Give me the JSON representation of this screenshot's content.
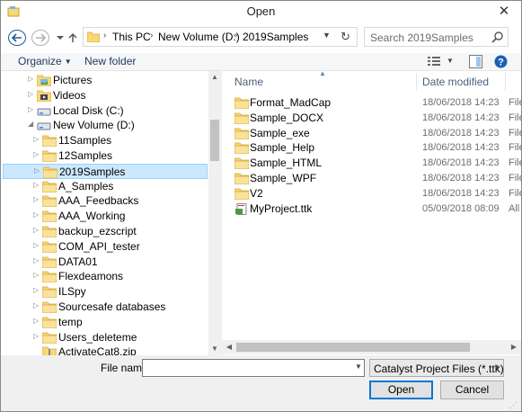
{
  "window": {
    "title": "Open",
    "close_glyph": "✕"
  },
  "nav": {
    "back_icon": "back-arrow-icon",
    "forward_icon": "forward-arrow-icon",
    "recent_icon": "chevron-down-icon",
    "up_icon": "up-arrow-icon",
    "breadcrumb": [
      "This PC",
      "New Volume (D:)",
      "2019Samples"
    ],
    "refresh_glyph": "↻"
  },
  "search": {
    "placeholder": "Search 2019Samples"
  },
  "toolbar": {
    "organize": "Organize",
    "new_folder": "New folder"
  },
  "tree": [
    {
      "label": "Pictures",
      "icon": "pictures-icon",
      "indent": 1,
      "selected": false
    },
    {
      "label": "Videos",
      "icon": "videos-icon",
      "indent": 1,
      "selected": false
    },
    {
      "label": "Local Disk (C:)",
      "icon": "drive-icon",
      "indent": 1,
      "selected": false
    },
    {
      "label": "New Volume (D:)",
      "icon": "drive-icon",
      "indent": 1,
      "expanded": true,
      "selected": false
    },
    {
      "label": "11Samples",
      "icon": "folder-icon",
      "indent": 2,
      "selected": false
    },
    {
      "label": "12Samples",
      "icon": "folder-icon",
      "indent": 2,
      "selected": false
    },
    {
      "label": "2019Samples",
      "icon": "folder-icon",
      "indent": 2,
      "selected": true
    },
    {
      "label": "A_Samples",
      "icon": "folder-icon",
      "indent": 2,
      "selected": false
    },
    {
      "label": "AAA_Feedbacks",
      "icon": "folder-icon",
      "indent": 2,
      "selected": false
    },
    {
      "label": "AAA_Working",
      "icon": "folder-icon",
      "indent": 2,
      "selected": false
    },
    {
      "label": "backup_ezscript",
      "icon": "folder-icon",
      "indent": 2,
      "selected": false
    },
    {
      "label": "COM_API_tester",
      "icon": "folder-icon",
      "indent": 2,
      "selected": false
    },
    {
      "label": "DATA01",
      "icon": "folder-icon",
      "indent": 2,
      "selected": false
    },
    {
      "label": "Flexdeamons",
      "icon": "folder-icon",
      "indent": 2,
      "selected": false
    },
    {
      "label": "ILSpy",
      "icon": "folder-icon",
      "indent": 2,
      "selected": false
    },
    {
      "label": "Sourcesafe databases",
      "icon": "folder-icon",
      "indent": 2,
      "selected": false
    },
    {
      "label": "temp",
      "icon": "folder-icon",
      "indent": 2,
      "selected": false
    },
    {
      "label": "Users_deleteme",
      "icon": "folder-icon",
      "indent": 2,
      "selected": false
    },
    {
      "label": "ActivateCat8.zip",
      "icon": "zip-icon",
      "indent": 2,
      "file": true,
      "selected": false
    }
  ],
  "columns": {
    "name": "Name",
    "date": "Date modified"
  },
  "files": [
    {
      "name": "Format_MadCap",
      "date": "18/06/2018 14:23",
      "type": "File",
      "icon": "folder-icon"
    },
    {
      "name": "Sample_DOCX",
      "date": "18/06/2018 14:23",
      "type": "File",
      "icon": "folder-icon"
    },
    {
      "name": "Sample_exe",
      "date": "18/06/2018 14:23",
      "type": "File",
      "icon": "folder-icon"
    },
    {
      "name": "Sample_Help",
      "date": "18/06/2018 14:23",
      "type": "File",
      "icon": "folder-icon"
    },
    {
      "name": "Sample_HTML",
      "date": "18/06/2018 14:23",
      "type": "File",
      "icon": "folder-icon"
    },
    {
      "name": "Sample_WPF",
      "date": "18/06/2018 14:23",
      "type": "File",
      "icon": "folder-icon"
    },
    {
      "name": "V2",
      "date": "18/06/2018 14:23",
      "type": "File",
      "icon": "folder-icon"
    },
    {
      "name": "MyProject.ttk",
      "date": "05/09/2018 08:09",
      "type": "All",
      "icon": "project-file-icon"
    }
  ],
  "bottom": {
    "filename_label": "File name:",
    "filename_value": "",
    "filetype": "Catalyst Project Files (*.ttk)",
    "open": "Open",
    "cancel": "Cancel"
  },
  "colors": {
    "folder": "#f8d775",
    "selection": "#cce8ff",
    "accent": "#0078d7"
  }
}
